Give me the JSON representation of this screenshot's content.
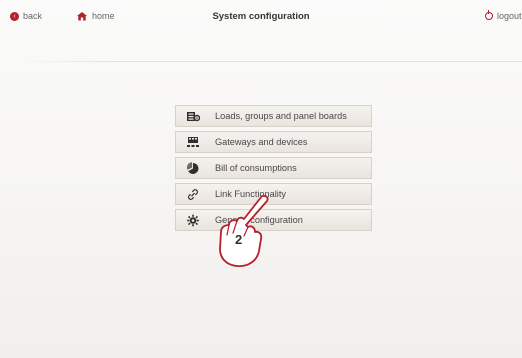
{
  "topbar": {
    "back_label": "back",
    "home_label": "home",
    "title": "System configuration",
    "logout_label": "logout"
  },
  "menu": {
    "items": [
      {
        "label": "Loads, groups and panel boards",
        "icon": "loads-panel-icon"
      },
      {
        "label": "Gateways and devices",
        "icon": "gateway-device-icon"
      },
      {
        "label": "Bill of consumptions",
        "icon": "consumption-pie-icon"
      },
      {
        "label": "Link Functionality",
        "icon": "link-icon"
      },
      {
        "label": "General configuration",
        "icon": "gear-icon"
      }
    ]
  },
  "annotation": {
    "step_number": "2"
  },
  "colors": {
    "accent": "#b51f2a",
    "button_border": "#d8d1c8",
    "text": "#4b4646"
  }
}
